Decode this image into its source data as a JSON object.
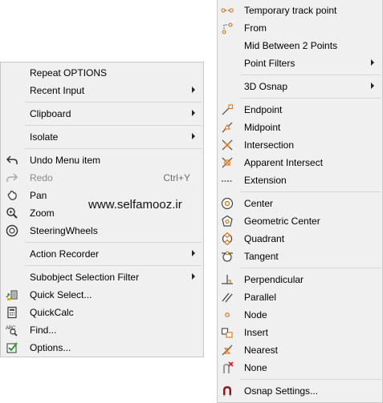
{
  "left_menu": {
    "items": [
      {
        "label": "Repeat OPTIONS"
      },
      {
        "label": "Recent Input"
      },
      {
        "label": "Clipboard"
      },
      {
        "label": "Isolate"
      },
      {
        "label": "Undo Menu item",
        "icon": "undo-icon"
      },
      {
        "label": "Redo",
        "shortcut": "Ctrl+Y",
        "icon": "redo-icon"
      },
      {
        "label": "Pan",
        "icon": "pan-icon"
      },
      {
        "label": "Zoom",
        "icon": "zoom-icon"
      },
      {
        "label": "SteeringWheels",
        "icon": "steering-wheel-icon"
      },
      {
        "label": "Action Recorder"
      },
      {
        "label": "Subobject Selection Filter"
      },
      {
        "label": "Quick Select...",
        "icon": "quick-select-icon"
      },
      {
        "label": "QuickCalc",
        "icon": "calculator-icon"
      },
      {
        "label": "Find...",
        "icon": "find-text-icon"
      },
      {
        "label": "Options...",
        "icon": "options-check-icon"
      }
    ]
  },
  "watermark": "www.selfamooz.ir",
  "right_menu": {
    "items": [
      {
        "label": "Temporary track point",
        "icon": "temporary-track-point-icon"
      },
      {
        "label": "From",
        "icon": "from-icon"
      },
      {
        "label": "Mid Between 2 Points"
      },
      {
        "label": "Point Filters"
      },
      {
        "label": "3D Osnap"
      },
      {
        "label": "Endpoint",
        "icon": "endpoint-icon"
      },
      {
        "label": "Midpoint",
        "icon": "midpoint-icon"
      },
      {
        "label": "Intersection",
        "icon": "intersection-icon"
      },
      {
        "label": "Apparent Intersect",
        "icon": "apparent-intersect-icon"
      },
      {
        "label": "Extension",
        "icon": "extension-icon"
      },
      {
        "label": "Center",
        "icon": "center-icon"
      },
      {
        "label": "Geometric Center",
        "icon": "geometric-center-icon"
      },
      {
        "label": "Quadrant",
        "icon": "quadrant-icon"
      },
      {
        "label": "Tangent",
        "icon": "tangent-icon"
      },
      {
        "label": "Perpendicular",
        "icon": "perpendicular-icon"
      },
      {
        "label": "Parallel",
        "icon": "parallel-icon"
      },
      {
        "label": "Node",
        "icon": "node-icon"
      },
      {
        "label": "Insert",
        "icon": "insert-icon"
      },
      {
        "label": "Nearest",
        "icon": "nearest-icon"
      },
      {
        "label": "None",
        "icon": "none-icon"
      },
      {
        "label": "Osnap Settings...",
        "icon": "osnap-settings-icon"
      }
    ]
  },
  "colors": {
    "menu_bg": "#f0f0f0",
    "separator": "#d6d6d6",
    "snap_orange": "#e07a1f",
    "disabled_text": "#8a8a8a"
  }
}
